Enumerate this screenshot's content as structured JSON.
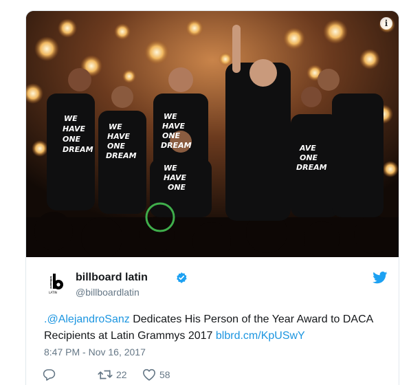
{
  "photo": {
    "alt_icon": "info-icon",
    "info_label": "i",
    "shirt_text": [
      "WE",
      "HAVE",
      "ONE",
      "DREAM"
    ]
  },
  "author": {
    "display_name": "billboard latin",
    "handle": "@billboardlatin",
    "avatar_label": "LATIN",
    "verified_icon": "verified-badge-icon",
    "brand_icon": "twitter-bird-icon"
  },
  "tweet": {
    "mention": ".@AlejandroSanz",
    "text": " Dedicates His Person of the Year Award to DACA Recipients at Latin Grammys 2017 ",
    "link": "blbrd.cm/KpUSwY",
    "timestamp": "8:47 PM - Nov 16, 2017"
  },
  "actions": {
    "reply_icon": "reply-icon",
    "retweet_icon": "retweet-icon",
    "retweet_count": "22",
    "like_icon": "heart-icon",
    "like_count": "58"
  },
  "colors": {
    "link": "#1b95e0",
    "verified": "#1da1f2",
    "muted": "#657786",
    "text": "#14171a"
  }
}
